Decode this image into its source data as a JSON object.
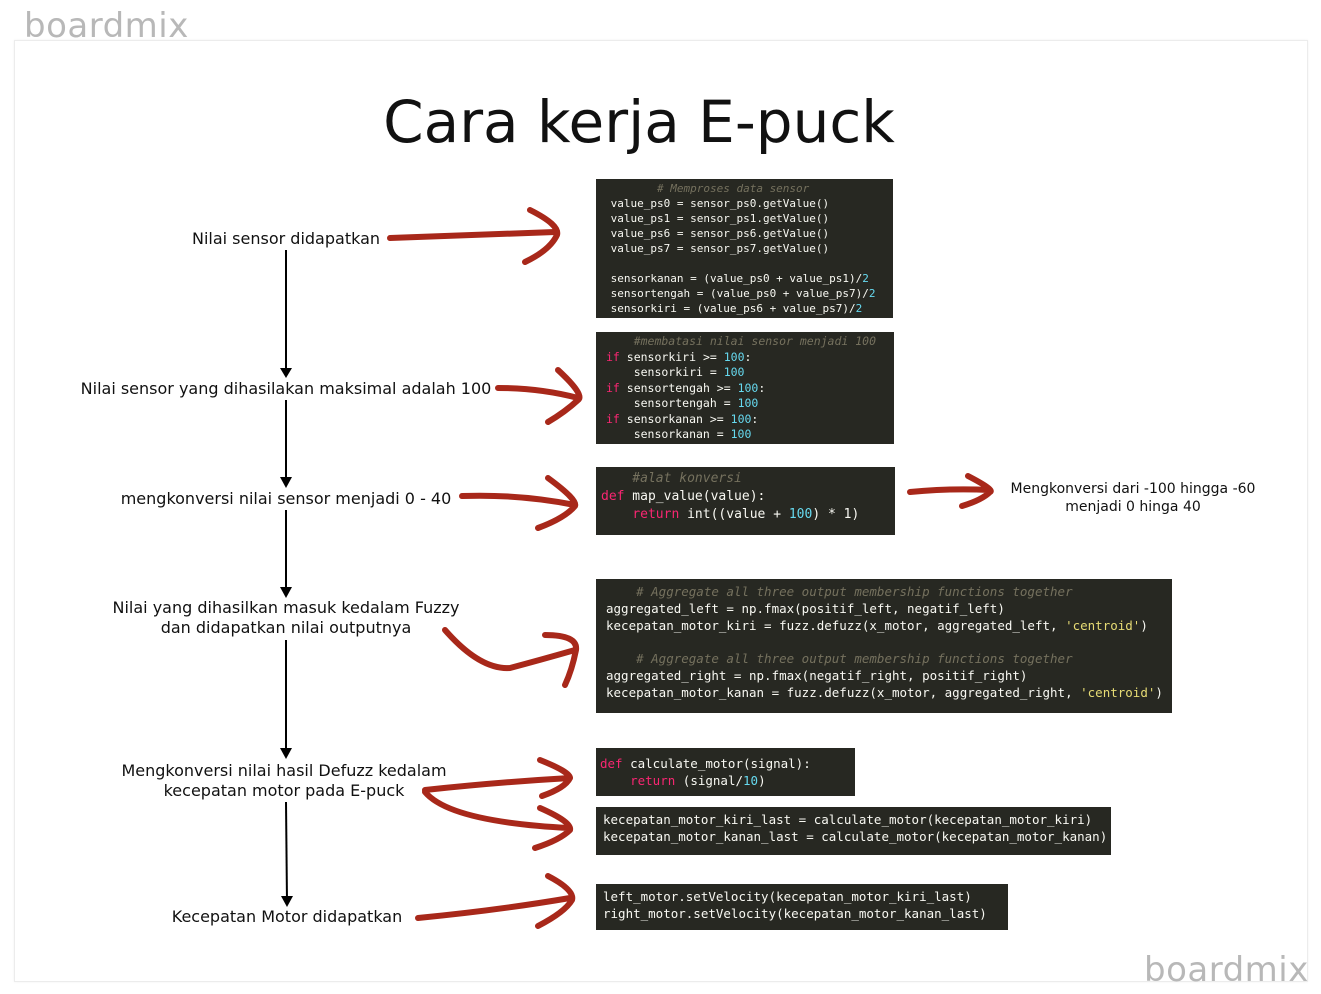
{
  "watermark": "boardmix",
  "title": "Cara kerja E-puck",
  "colors": {
    "arrow": "#a8281a",
    "code_bg": "#272822",
    "comment": "#75715e",
    "keyword": "#f92672",
    "number": "#66d9ef",
    "string": "#e6db74"
  },
  "steps": [
    {
      "lines": [
        "Nilai sensor didapatkan"
      ]
    },
    {
      "lines": [
        "Nilai sensor yang dihasilakan maksimal adalah 100"
      ]
    },
    {
      "lines": [
        "mengkonversi nilai sensor menjadi 0 - 40"
      ]
    },
    {
      "lines": [
        "Nilai yang dihasilkan masuk kedalam Fuzzy",
        "dan didapatkan nilai outputnya"
      ]
    },
    {
      "lines": [
        "Mengkonversi nilai hasil Defuzz kedalam",
        "kecepatan motor pada E-puck"
      ]
    },
    {
      "lines": [
        "Kecepatan Motor didapatkan"
      ]
    }
  ],
  "note": {
    "lines": [
      "Mengkonversi dari -100 hingga -60",
      "menjadi 0 hinga 40"
    ]
  },
  "code_blocks": [
    {
      "lines": [
        [
          {
            "t": "        # Memproses data sensor",
            "c": "cm"
          }
        ],
        [
          {
            "t": " value_ps0 = sensor_ps0.getValue()",
            "c": "tx"
          }
        ],
        [
          {
            "t": " value_ps1 = sensor_ps1.getValue()",
            "c": "tx"
          }
        ],
        [
          {
            "t": " value_ps6 = sensor_ps6.getValue()",
            "c": "tx"
          }
        ],
        [
          {
            "t": " value_ps7 = sensor_ps7.getValue()",
            "c": "tx"
          }
        ],
        [
          {
            "t": " ",
            "c": "tx"
          }
        ],
        [
          {
            "t": " sensorkanan = (value_ps0 + value_ps1)/",
            "c": "tx"
          },
          {
            "t": "2",
            "c": "num"
          }
        ],
        [
          {
            "t": " sensortengah = (value_ps0 + value_ps7)/",
            "c": "tx"
          },
          {
            "t": "2",
            "c": "num"
          }
        ],
        [
          {
            "t": " sensorkiri = (value_ps6 + value_ps7)/",
            "c": "tx"
          },
          {
            "t": "2",
            "c": "num"
          }
        ]
      ]
    },
    {
      "lines": [
        [
          {
            "t": "    #membatasi nilai sensor menjadi 100",
            "c": "cm"
          }
        ],
        [
          {
            "t": "if",
            "c": "kw"
          },
          {
            "t": " sensorkiri >= ",
            "c": "tx"
          },
          {
            "t": "100",
            "c": "num"
          },
          {
            "t": ":",
            "c": "tx"
          }
        ],
        [
          {
            "t": "    sensorkiri = ",
            "c": "tx"
          },
          {
            "t": "100",
            "c": "num"
          }
        ],
        [
          {
            "t": "if",
            "c": "kw"
          },
          {
            "t": " sensortengah >= ",
            "c": "tx"
          },
          {
            "t": "100",
            "c": "num"
          },
          {
            "t": ":",
            "c": "tx"
          }
        ],
        [
          {
            "t": "    sensortengah = ",
            "c": "tx"
          },
          {
            "t": "100",
            "c": "num"
          }
        ],
        [
          {
            "t": "if",
            "c": "kw"
          },
          {
            "t": " sensorkanan >= ",
            "c": "tx"
          },
          {
            "t": "100",
            "c": "num"
          },
          {
            "t": ":",
            "c": "tx"
          }
        ],
        [
          {
            "t": "    sensorkanan = ",
            "c": "tx"
          },
          {
            "t": "100",
            "c": "num"
          }
        ]
      ]
    },
    {
      "lines": [
        [
          {
            "t": "    #alat konversi",
            "c": "cm"
          }
        ],
        [
          {
            "t": "def",
            "c": "kw"
          },
          {
            "t": " map_value(value):",
            "c": "tx"
          }
        ],
        [
          {
            "t": "    ",
            "c": "tx"
          },
          {
            "t": "return",
            "c": "kw"
          },
          {
            "t": " int((value + ",
            "c": "tx"
          },
          {
            "t": "100",
            "c": "num"
          },
          {
            "t": ") * 1)",
            "c": "tx"
          }
        ]
      ]
    },
    {
      "lines": [
        [
          {
            "t": "    # Aggregate all three output membership functions together",
            "c": "cm"
          }
        ],
        [
          {
            "t": "aggregated_left = np.fmax(positif_left, negatif_left)",
            "c": "tx"
          }
        ],
        [
          {
            "t": "kecepatan_motor_kiri = fuzz.defuzz(x_motor, aggregated_left, ",
            "c": "tx"
          },
          {
            "t": "'centroid'",
            "c": "str"
          },
          {
            "t": ")",
            "c": "tx"
          }
        ],
        [
          {
            "t": " ",
            "c": "tx"
          }
        ],
        [
          {
            "t": "    # Aggregate all three output membership functions together",
            "c": "cm"
          }
        ],
        [
          {
            "t": "aggregated_right = np.fmax(negatif_right, positif_right)",
            "c": "tx"
          }
        ],
        [
          {
            "t": "kecepatan_motor_kanan = fuzz.defuzz(x_motor, aggregated_right, ",
            "c": "tx"
          },
          {
            "t": "'centroid'",
            "c": "str"
          },
          {
            "t": ")",
            "c": "tx"
          }
        ]
      ]
    },
    {
      "lines": [
        [
          {
            "t": "def",
            "c": "kw"
          },
          {
            "t": " calculate_motor(signal):",
            "c": "tx"
          }
        ],
        [
          {
            "t": "    ",
            "c": "tx"
          },
          {
            "t": "return",
            "c": "kw"
          },
          {
            "t": " (signal/",
            "c": "tx"
          },
          {
            "t": "10",
            "c": "num"
          },
          {
            "t": ")",
            "c": "tx"
          }
        ]
      ]
    },
    {
      "lines": [
        [
          {
            "t": "kecepatan_motor_kiri_last = calculate_motor(kecepatan_motor_kiri)",
            "c": "tx"
          }
        ],
        [
          {
            "t": "kecepatan_motor_kanan_last = calculate_motor(kecepatan_motor_kanan)",
            "c": "tx"
          }
        ]
      ]
    },
    {
      "lines": [
        [
          {
            "t": "left_motor.setVelocity(kecepatan_motor_kiri_last)",
            "c": "tx"
          }
        ],
        [
          {
            "t": "right_motor.setVelocity(kecepatan_motor_kanan_last)",
            "c": "tx"
          }
        ]
      ]
    }
  ]
}
